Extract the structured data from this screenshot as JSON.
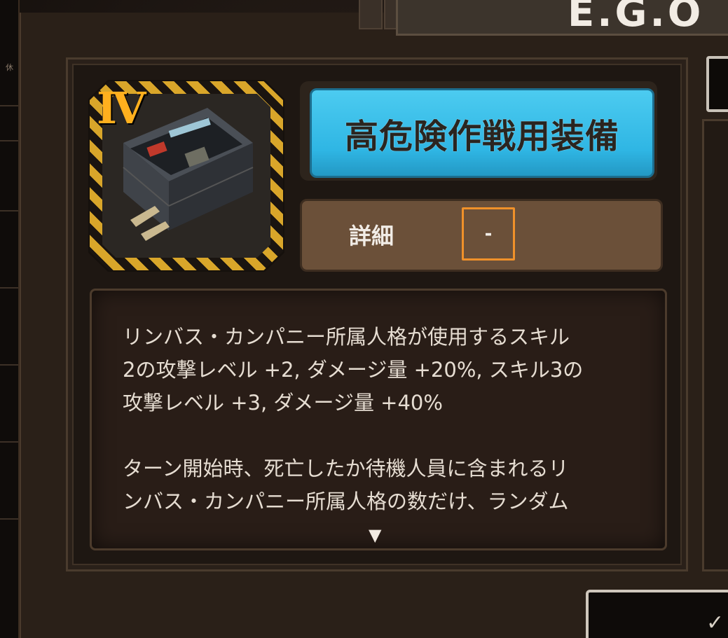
{
  "top_title": "E.G.O",
  "left_strip": {
    "mini_text": "休"
  },
  "item": {
    "rank": "Ⅳ",
    "name": "高危険作戦用装備",
    "detail_label": "詳細",
    "detail_value": "-",
    "description": "リンバス・カンパニー所属人格が使用するスキル\n2の攻撃レベル +2, ダメージ量 +20%, スキル3の\n攻撃レベル +3, ダメージ量 +40%\n\nターン開始時、死亡したか待機人員に含まれるリ\nンバス・カンパニー所属人格の数だけ、ランダム\n"
  },
  "icons": {
    "item_icon": "ammo-crate-icon",
    "scroll": "scroll-down-arrow-icon",
    "expand": "chevron-down-icon"
  },
  "colors": {
    "name_bg": "#38bde8",
    "rank": "#ffb01e",
    "detail_border": "#f0912a"
  }
}
